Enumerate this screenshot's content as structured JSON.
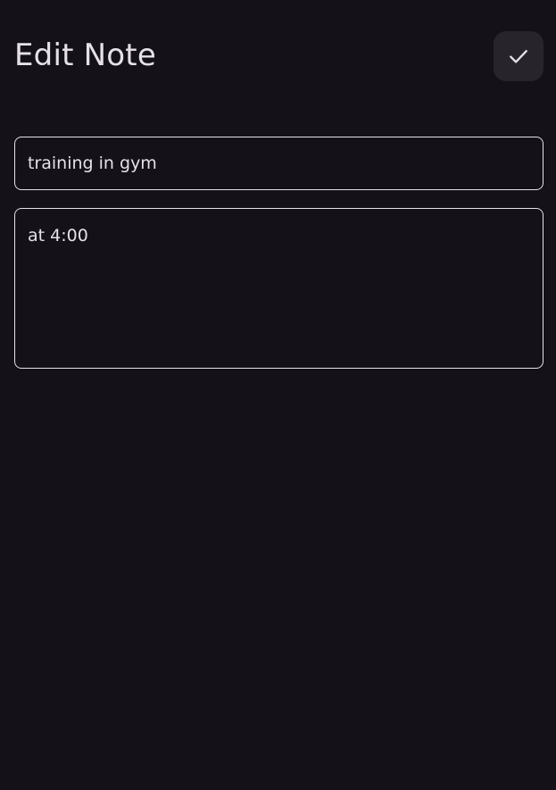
{
  "header": {
    "title": "Edit Note",
    "save_icon": "check-icon"
  },
  "form": {
    "title_value": "training in gym",
    "content_value": "at 4:00"
  },
  "colors": {
    "background": "#141218",
    "text": "#e6e0e9",
    "button_bg": "#27252b",
    "field_border": "#e6e0e9"
  }
}
